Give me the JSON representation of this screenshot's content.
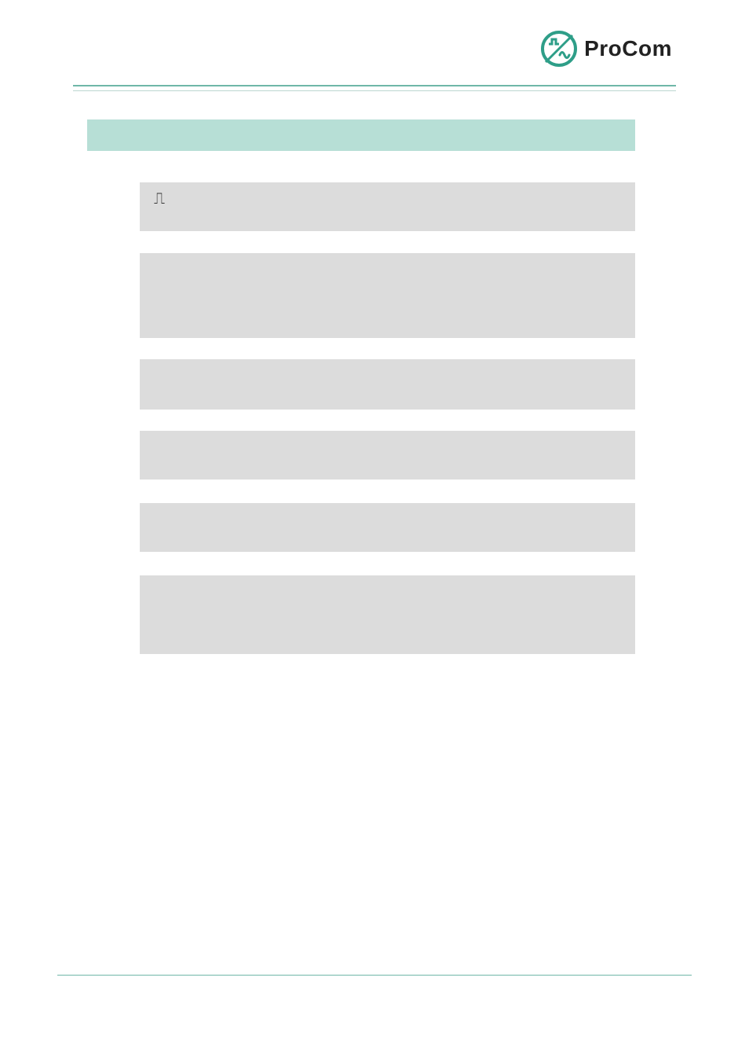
{
  "brand": {
    "name": "ProCom",
    "accent": "#2e9e88",
    "dark": "#1f7a68"
  },
  "header": {
    "rule_color_primary": "#6fb7a8",
    "rule_color_secondary": "#bcd7d1"
  },
  "section": {
    "title": ""
  },
  "blocks": [
    {
      "id": "block-1",
      "glyph": "⎍",
      "text": ""
    },
    {
      "id": "block-2",
      "glyph": "",
      "text": ""
    },
    {
      "id": "block-3",
      "glyph": "",
      "text": ""
    },
    {
      "id": "block-4",
      "glyph": "",
      "text": ""
    },
    {
      "id": "block-5",
      "glyph": "",
      "text": ""
    },
    {
      "id": "block-6",
      "glyph": "",
      "text": ""
    }
  ],
  "footer": {
    "rule_color": "#6fb7a8"
  }
}
